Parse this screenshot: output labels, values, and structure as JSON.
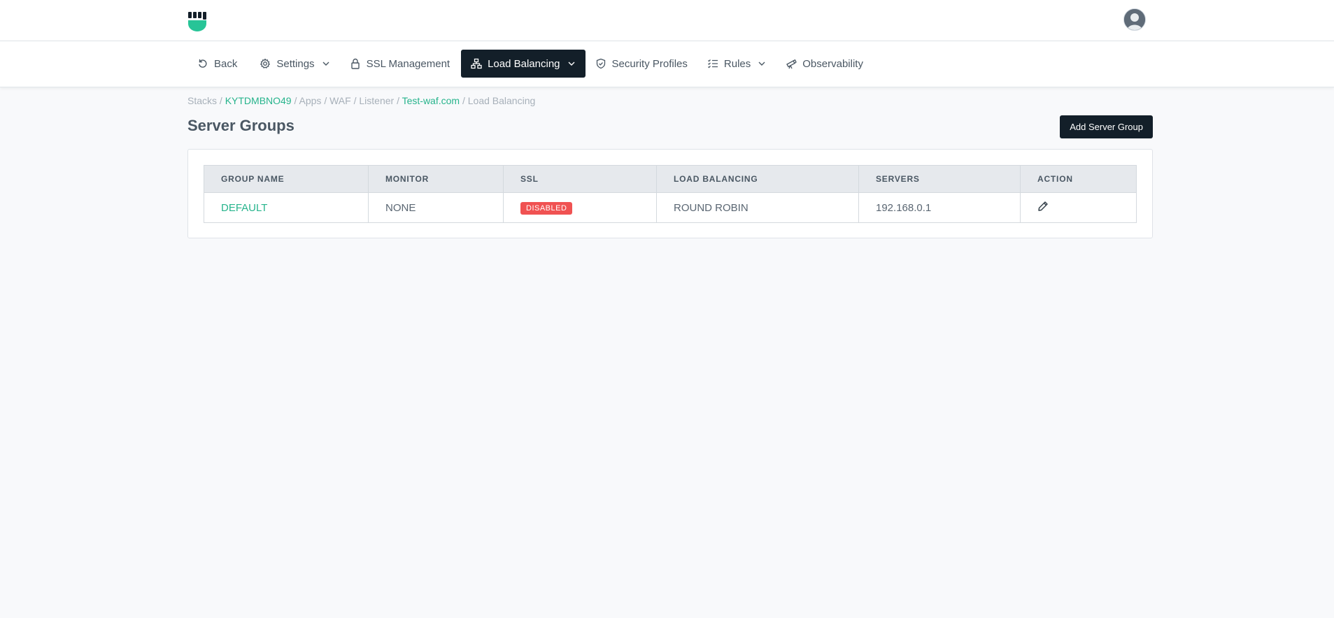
{
  "nav": {
    "items": [
      {
        "label": "Back",
        "icon": "back-icon"
      },
      {
        "label": "Settings",
        "icon": "gear-icon"
      },
      {
        "label": "SSL Management",
        "icon": "lock-icon"
      },
      {
        "label": "Load Balancing",
        "icon": "network-icon"
      },
      {
        "label": "Security Profiles",
        "icon": "shield-icon"
      },
      {
        "label": "Rules",
        "icon": "list-check-icon"
      },
      {
        "label": "Observability",
        "icon": "telescope-icon"
      }
    ]
  },
  "breadcrumb": {
    "stacks": "Stacks",
    "stack_id": "KYTDMBNO49",
    "apps": "Apps",
    "waf": "WAF",
    "listener": "Listener",
    "domain": "Test-waf.com",
    "current": "Load Balancing",
    "separator": " / "
  },
  "page": {
    "title": "Server Groups",
    "add_button": "Add Server Group"
  },
  "table": {
    "headers": [
      "GROUP NAME",
      "MONITOR",
      "SSL",
      "LOAD BALANCING",
      "SERVERS",
      "ACTION"
    ],
    "rows": [
      {
        "group_name": "DEFAULT",
        "monitor": "NONE",
        "ssl": "DISABLED",
        "load_balancing": "ROUND ROBIN",
        "servers": "192.168.0.1"
      }
    ]
  },
  "colors": {
    "accent": "#27b48c",
    "dark": "#131f29",
    "danger": "#f05252"
  }
}
